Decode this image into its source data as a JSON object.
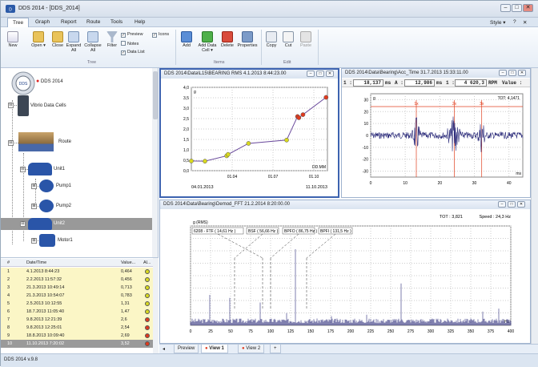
{
  "window": {
    "title": "DDS 2014 - [DDS_2014]",
    "style_label": "Style"
  },
  "menu": [
    "Tree",
    "Graph",
    "Report",
    "Route",
    "Tools",
    "Help"
  ],
  "ribbon": {
    "tree_group": "Tree",
    "items_group": "Items",
    "edit_group": "Edit",
    "new": "New",
    "open": "Open",
    "close": "Close",
    "expand_all": "Expand All",
    "collapse_all": "Collapse All",
    "filter": "Filter",
    "preview": "Preview",
    "icons": "Icons",
    "notes": "Notes",
    "data_list": "Data List",
    "add": "Add",
    "add_data_cell": "Add Data Cell",
    "delete": "Delete",
    "properties": "Properties",
    "copy": "Copy",
    "cut": "Cut",
    "paste": "Paste"
  },
  "tree": {
    "root": "DDS 2014",
    "vibrio": "Vibrio Data Cells",
    "route": "Route",
    "unit1": "Unit1",
    "pump1": "Pump1",
    "pump2": "Pump2",
    "unit2": "Unit2",
    "motor1": "Motor1"
  },
  "table": {
    "headers": [
      "#",
      "Date/Time",
      "Value...",
      "Al..."
    ],
    "rows": [
      {
        "n": "1",
        "dt": "4.1.2013 8:44:23",
        "v": "0,464",
        "c": "#d8d820"
      },
      {
        "n": "2",
        "dt": "2.2.2013 11:57:32",
        "v": "0,456",
        "c": "#d8d820"
      },
      {
        "n": "3",
        "dt": "21.3.2013 10:49:14",
        "v": "0,713",
        "c": "#d8d820"
      },
      {
        "n": "4",
        "dt": "21.3.2013 10:54:07",
        "v": "0,783",
        "c": "#d8d820"
      },
      {
        "n": "5",
        "dt": "2.5.2013 10:12:55",
        "v": "1,31",
        "c": "#d8d820"
      },
      {
        "n": "6",
        "dt": "18.7.2013 11:05:40",
        "v": "1,47",
        "c": "#d8d820"
      },
      {
        "n": "7",
        "dt": "9.8.2013 12:21:39",
        "v": "2,6",
        "c": "#e03a1e"
      },
      {
        "n": "8",
        "dt": "9.8.2013 12:25:01",
        "v": "2,54",
        "c": "#e03a1e"
      },
      {
        "n": "9",
        "dt": "18.8.2013 10:09:40",
        "v": "2,69",
        "c": "#e03a1e"
      },
      {
        "n": "10",
        "dt": "11.10.2013 7:20:02",
        "v": "3,52",
        "c": "#e03a1e"
      }
    ]
  },
  "status": "DDS 2014 v.9.8",
  "trend": {
    "title": "DDS 2014\\Data\\L15\\BEARING RMS    4.1.2013 8:44:23.00",
    "unit": "g",
    "xunit": "DD.MM",
    "date_start": "04.01.2013",
    "date_end": "11.10.2013",
    "yticks": [
      "4,0",
      "3,5",
      "3,0",
      "2,5",
      "2,0",
      "1,5",
      "1,0",
      "0,5",
      "0,0"
    ],
    "xticks": [
      "01.04",
      "01.07",
      "01.10"
    ]
  },
  "time": {
    "title": "DDS 2014\\Data\\Bearing\\Acc_Time   31.7.2013 15:33:11.00",
    "r1_label": "1 :",
    "r1_val": "18,137",
    "r1_unit": "ms",
    "r2_label": "A :",
    "r2_val": "12,986",
    "r2_unit": "ms",
    "r3_label": "1 :",
    "r3_val": "4 620,3",
    "r3_unit": "RPM",
    "value_label": "Value :",
    "tot": "TOT: 4,1471",
    "unit": "g",
    "xunit": "ms",
    "cursors": [
      "1x",
      "2x",
      "3x"
    ],
    "yticks": [
      "30",
      "20",
      "10",
      "0",
      "-10",
      "-20",
      "-30"
    ],
    "xticks": [
      "0",
      "10",
      "20",
      "30",
      "40"
    ]
  },
  "fft": {
    "title": "DDS 2014\\Data\\Bearing\\Demod_FFT   21.2.2014 8:20:00.00",
    "unit": "g (RMS)",
    "tot": "TOT : 3,821",
    "speed": "Speed : 24,3 Hz",
    "xunit": "Hz",
    "labels": [
      "6208 - FTF  ( 14,61 Hz )",
      "BSF  ( 56,66 Hz )",
      "BPFO  ( 86,75 Hz )",
      "BPFI  ( 131,5 Hz )"
    ],
    "xticks": [
      "0",
      "25",
      "50",
      "75",
      "100",
      "125",
      "150",
      "175",
      "200",
      "225",
      "250",
      "275",
      "300",
      "325",
      "350",
      "375",
      "400"
    ]
  },
  "tabs": [
    "Preview",
    "View 1",
    "View 2",
    "+"
  ],
  "chart_data": [
    {
      "type": "line",
      "title": "DDS 2014\\Data\\L15\\BEARING RMS    4.1.2013 8:44:23.00",
      "ylabel": "g",
      "ylim": [
        0,
        4
      ],
      "x": [
        "4.1.2013",
        "2.2.2013",
        "21.3.2013",
        "21.3.2013",
        "2.5.2013",
        "18.7.2013",
        "9.8.2013",
        "9.8.2013",
        "18.8.2013",
        "11.10.2013"
      ],
      "values": [
        0.464,
        0.456,
        0.713,
        0.783,
        1.31,
        1.47,
        2.6,
        2.54,
        2.69,
        3.52
      ]
    }
  ]
}
